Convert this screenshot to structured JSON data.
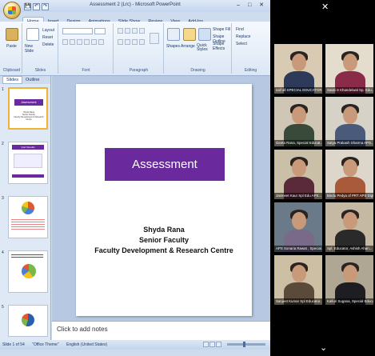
{
  "window": {
    "title": "Assessment 2 (Lrc) - Microsoft PowerPoint",
    "controls": "–  □  ✕"
  },
  "quick_access": [
    "💾",
    "↶",
    "↷"
  ],
  "ribbon_tabs": [
    "Home",
    "Insert",
    "Design",
    "Animations",
    "Slide Show",
    "Review",
    "View",
    "Add-Ins"
  ],
  "ribbon": {
    "groups": [
      "Clipboard",
      "Slides",
      "Font",
      "Paragraph",
      "Drawing",
      "Editing"
    ],
    "paste": "Paste",
    "new_slide": "New Slide",
    "layout": "Layout",
    "reset": "Reset",
    "delete": "Delete",
    "shapes": "Shapes",
    "arrange": "Arrange",
    "quick_styles": "Quick Styles",
    "shape_fill": "Shape Fill",
    "shape_outline": "Shape Outline",
    "shape_effects": "Shape Effects",
    "find": "Find",
    "replace": "Replace",
    "select": "Select"
  },
  "pane_tabs": [
    "Slides",
    "Outline"
  ],
  "thumbnails": [
    {
      "num": "1",
      "title": "Assessment",
      "lines": "Shyda Rana\nSenior Faculty\nFaculty Development & Research Centre"
    },
    {
      "num": "2",
      "title": "Quiz Results",
      "lines": ""
    },
    {
      "num": "3",
      "title": "",
      "lines": ""
    },
    {
      "num": "4",
      "title": "",
      "lines": ""
    },
    {
      "num": "5",
      "title": "",
      "lines": ""
    }
  ],
  "slide": {
    "title": "Assessment",
    "name": "Shyda Rana",
    "role": "Senior Faculty",
    "org": "Faculty Development & Research Centre"
  },
  "notes_placeholder": "Click to add notes",
  "status": {
    "slide": "Slide 1 of 54",
    "theme": "\"Office Theme\"",
    "language": "English (United States)"
  },
  "participants": [
    {
      "name": "saif all SPECIAL EDUCATOR...",
      "bg": "#d9cbb3",
      "shirt": "#2d3a5a"
    },
    {
      "name": "Swati S Khandelwal Sp. Edu...",
      "bg": "#e4dccd",
      "shirt": "#8a2b4a"
    },
    {
      "name": "Geeta Rana, Special Educat...",
      "bg": "#cfc6b6",
      "shirt": "#3a4a3a"
    },
    {
      "name": "Satya Prakash Sharma APS...",
      "bg": "#d6d2c8",
      "shirt": "#4a5a7a"
    },
    {
      "name": "Jasmeet Kaur Spl Edu APS...",
      "bg": "#c9c0a7",
      "shirt": "#5a2a3a"
    },
    {
      "name": "Bindu Pedya of PRT APS Digh...",
      "bg": "#ddd6cb",
      "shirt": "#a85a3a"
    },
    {
      "name": "APS Sonaria Rawat , Special...",
      "bg": "#6a7a88",
      "shirt": "#7a6a8a"
    },
    {
      "name": "Spl. Educator, Ashish Ahan...",
      "bg": "#c5b9a3",
      "shirt": "#2a2a2a"
    },
    {
      "name": "Sanjeet Kumar Spl Educator...",
      "bg": "#cdbfa4",
      "shirt": "#5a4a3a"
    },
    {
      "name": "Kalluri Sugana, Special Educat...",
      "bg": "#b0a694",
      "shirt": "#1e1e22"
    }
  ]
}
